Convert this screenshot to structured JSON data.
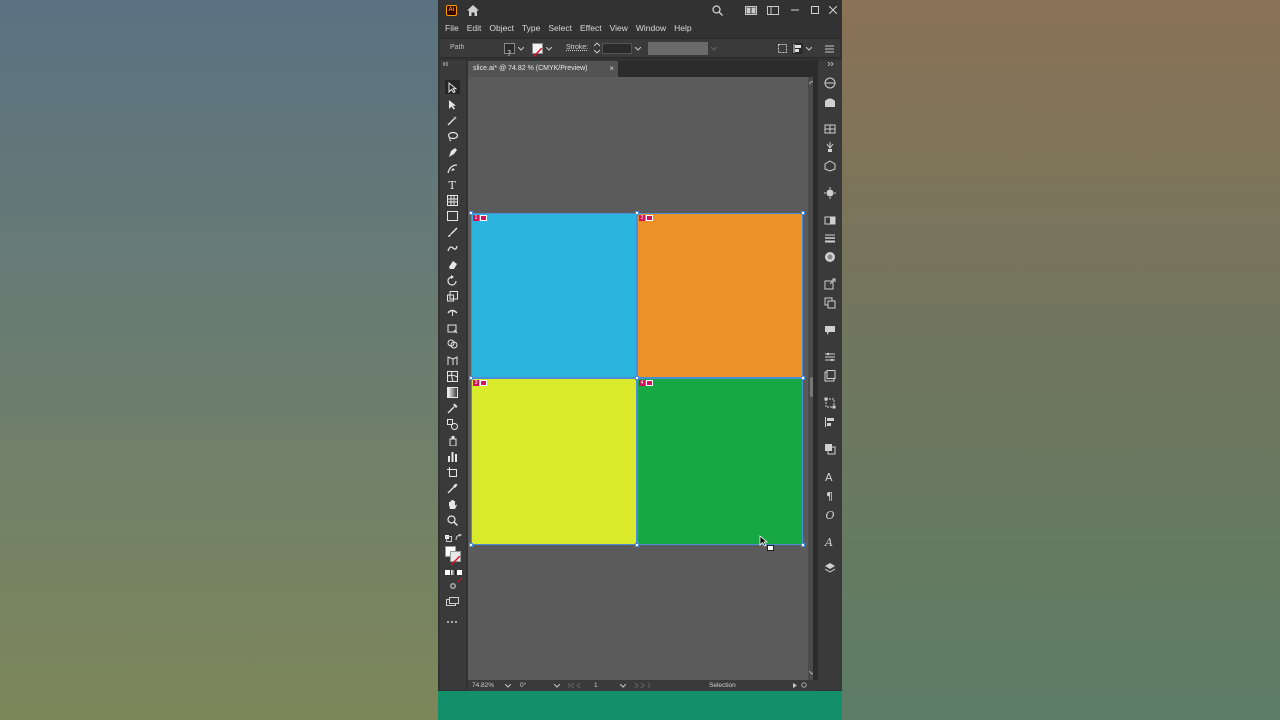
{
  "app": {
    "logo_text": "Ai",
    "menu": [
      "File",
      "Edit",
      "Object",
      "Type",
      "Select",
      "Effect",
      "View",
      "Window",
      "Help"
    ]
  },
  "control_bar": {
    "selection_type": "Path",
    "stroke_label": "Stroke:"
  },
  "document": {
    "tab_title": "slice.ai* @ 74.82 % (CMYK/Preview)",
    "close_glyph": "×"
  },
  "slices": [
    {
      "number": "1",
      "color": "#2bb5de"
    },
    {
      "number": "2",
      "color": "#ec9125"
    },
    {
      "number": "3",
      "color": "#d9eb2b"
    },
    {
      "number": "4",
      "color": "#17a843"
    }
  ],
  "status": {
    "zoom": "74.82%",
    "rotation": "0°",
    "artboard": "1",
    "tool": "Selection"
  },
  "colors": {
    "ui_dark": "#323232",
    "canvas": "#5b5b5b",
    "selection": "#4a8ed8",
    "slice_badge": "#d4145a",
    "footer": "#12906a"
  }
}
